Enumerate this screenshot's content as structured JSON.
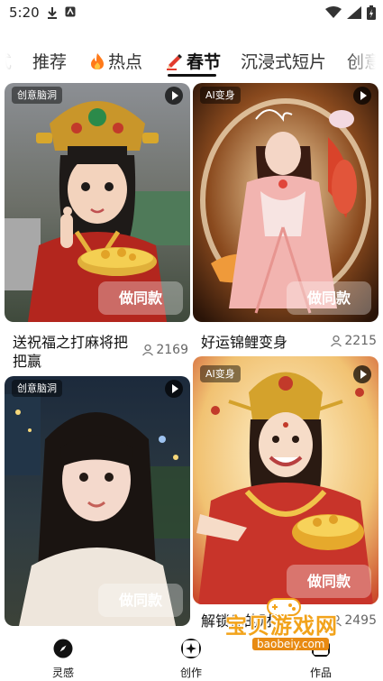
{
  "status_bar": {
    "time": "5:20"
  },
  "tabs": [
    {
      "label": "推荐"
    },
    {
      "label": "热点"
    },
    {
      "label": "春节"
    },
    {
      "label": "沉浸式短片"
    },
    {
      "label": "创意"
    }
  ],
  "cards": [
    {
      "badge": "创意脑洞",
      "button": "做同款",
      "title": "送祝福之打麻将把把赢",
      "count": "2169"
    },
    {
      "badge": "AI变身",
      "button": "做同款",
      "title": "好运锦鲤变身",
      "count": "2215"
    },
    {
      "badge": "创意脑洞",
      "button": "做同款"
    },
    {
      "badge": "AI变身",
      "button": "做同款",
      "title": "解锁你的财",
      "count": "2495"
    }
  ],
  "bottom_nav": [
    {
      "label": "灵感",
      "icon": "compass-icon"
    },
    {
      "label": "创作",
      "icon": "sparkle-icon"
    },
    {
      "label": "作品",
      "icon": "folder-icon"
    }
  ],
  "watermark": {
    "text": "宝贝游戏网",
    "url": "baobeiy.com"
  },
  "colors": {
    "accent": "#111111",
    "watermark": "#f2a31b",
    "fire": "#ff7a1a",
    "pencil": "#e23b2e"
  }
}
